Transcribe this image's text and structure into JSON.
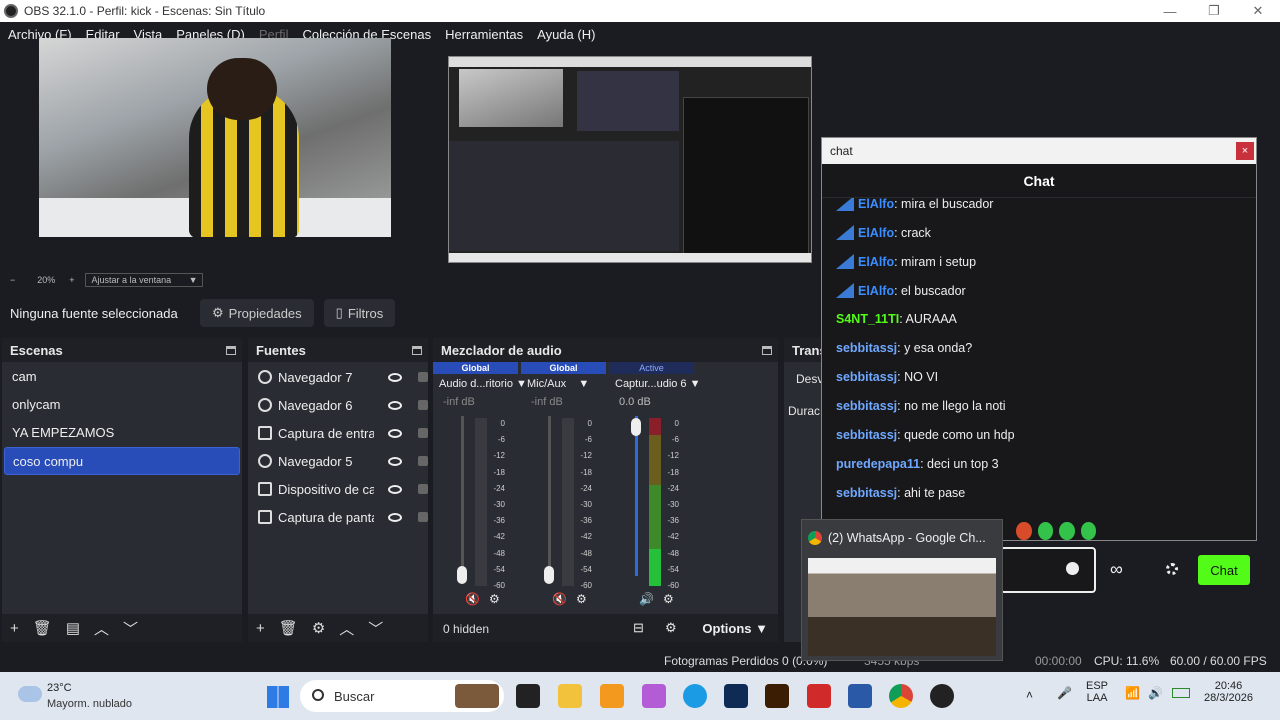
{
  "window": {
    "title": "OBS 32.1.0 - Perfil: kick - Escenas: Sin Título"
  },
  "menu": [
    "Archivo (F)",
    "Editar",
    "Vista",
    "Paneles (D)",
    "Perfil",
    "Colección de Escenas",
    "Herramientas",
    "Ayuda (H)"
  ],
  "zoom": {
    "minus": "−",
    "value": "20%",
    "plus": "+",
    "fit": "Ajustar a la ventana"
  },
  "source_toolbar": {
    "no_selection": "Ninguna fuente seleccionada",
    "properties": "Propiedades",
    "filters": "Filtros"
  },
  "scenes": {
    "title": "Escenas",
    "items": [
      "cam",
      "onlycam",
      "YA EMPEZAMOS",
      "coso compu"
    ],
    "selected": "coso compu"
  },
  "sources": {
    "title": "Fuentes",
    "items": [
      "Navegador 7",
      "Navegador 6",
      "Captura de entrada",
      "Navegador 5",
      "Dispositivo de captura",
      "Captura de pantalla"
    ]
  },
  "mixer": {
    "title": "Mezclador de audio",
    "channels": [
      {
        "badge": "Global",
        "name": "Audio d...ritorio",
        "db": "-inf dB"
      },
      {
        "badge": "Global",
        "name": "Mic/Aux",
        "db": "-inf dB"
      },
      {
        "badge": "Active",
        "name": "Captur...udio 6",
        "db": "0.0 dB"
      }
    ],
    "scale": [
      "0",
      "-6",
      "-12",
      "-18",
      "-24",
      "-30",
      "-36",
      "-42",
      "-48",
      "-54",
      "-60"
    ],
    "hidden": "0 hidden",
    "options": "Options"
  },
  "transitions": {
    "title": "Trans",
    "select": "Desv",
    "duration": "Durac"
  },
  "chat": {
    "window_title": "chat",
    "header": "Chat",
    "messages": [
      {
        "user": "ElAlfo",
        "text": ": mira el buscador",
        "style": "blue",
        "badge": true
      },
      {
        "user": "ElAlfo",
        "text": ": crack",
        "style": "blue",
        "badge": true
      },
      {
        "user": "ElAlfo",
        "text": ": miram i setup",
        "style": "blue",
        "badge": true
      },
      {
        "user": "ElAlfo",
        "text": ": el buscador",
        "style": "blue",
        "badge": true
      },
      {
        "user": "S4NT_11TI",
        "text": ": AURAAA",
        "style": "green",
        "badge": false
      },
      {
        "user": "sebbitassj",
        "text": ": y esa onda?",
        "style": "lblue",
        "badge": false
      },
      {
        "user": "sebbitassj",
        "text": ": NO VI",
        "style": "lblue",
        "badge": false
      },
      {
        "user": "sebbitassj",
        "text": ": no me llego la noti",
        "style": "lblue",
        "badge": false
      },
      {
        "user": "sebbitassj",
        "text": ": quede como un hdp",
        "style": "lblue",
        "badge": false
      },
      {
        "user": "puredepapa11",
        "text": ": deci un top 3",
        "style": "lblue",
        "badge": false
      },
      {
        "user": "sebbitassj",
        "text": ": ahi te pase",
        "style": "lblue",
        "badge": false
      }
    ],
    "send_label": "Chat",
    "close": "×"
  },
  "whatsapp_popup": {
    "title": "(2) WhatsApp - Google Ch..."
  },
  "status": {
    "dropped": "Fotogramas Perdidos 0 (0.0%)",
    "kbps": "3455 kbps",
    "time1": "00:00:00",
    "time2": "00:00:00",
    "cpu": "CPU: 11.6%",
    "fps": "60.00 / 60.00 FPS"
  },
  "taskbar": {
    "temp": "23°C",
    "condition": "Mayorm. nublado",
    "search": "Buscar",
    "lang1": "ESP",
    "lang2": "LAA",
    "time": "20:46",
    "date": "28/3/2026"
  },
  "colors": {
    "accent": "#284cb8",
    "kick_green": "#53fc18",
    "bg": "#1b1c22",
    "dock": "#2a2c33"
  }
}
